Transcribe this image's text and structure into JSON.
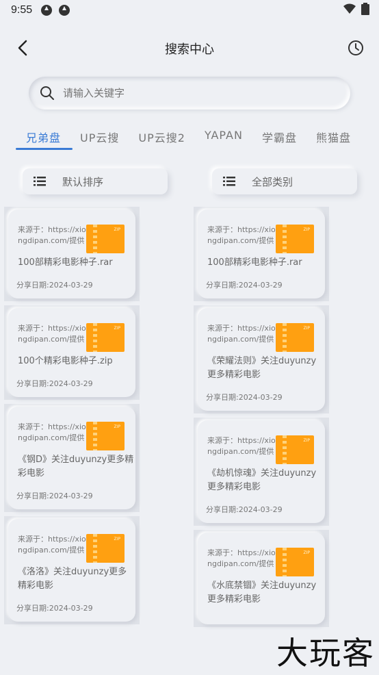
{
  "status_bar": {
    "time": "9:55"
  },
  "header": {
    "title": "搜索中心"
  },
  "search": {
    "placeholder": "请输入关键字"
  },
  "tabs": [
    "兄弟盘",
    "UP云搜",
    "UP云搜2",
    "YAPAN",
    "学霸盘",
    "熊猫盘"
  ],
  "sort": {
    "order_label": "默认排序",
    "category_label": "全部类别"
  },
  "columns": [
    [
      {
        "source": "来源于：https://xiongdipan.com/提供",
        "title": "100部精彩电影种子.rar",
        "date": "分享日期:2024-03-29"
      },
      {
        "source": "来源于：https://xiongdipan.com/提供",
        "title": "100个精彩电影种子.zip",
        "date": "分享日期:2024-03-29"
      },
      {
        "source": "来源于：https://xiongdipan.com/提供",
        "title": "《钢D》关注duyunzy更多精彩电影",
        "date": "分享日期:2024-03-29"
      },
      {
        "source": "来源于：https://xiongdipan.com/提供",
        "title": "《洛洛》关注duyunzy更多精彩电影",
        "date": "分享日期:2024-03-29"
      }
    ],
    [
      {
        "source": "来源于：https://xiongdipan.com/提供",
        "title": "100部精彩电影种子.rar",
        "date": "分享日期:2024-03-29"
      },
      {
        "source": "来源于：https://xiongdipan.com/提供",
        "title": "《荣耀法则》关注duyunzy更多精彩电影",
        "date": "分享日期:2024-03-29"
      },
      {
        "source": "来源于：https://xiongdipan.com/提供",
        "title": "《劫机惊魂》关注duyunzy更多精彩电影",
        "date": "分享日期:2024-03-29"
      },
      {
        "source": "来源于：https://xiongdipan.com/提供",
        "title": "《水底禁锢》关注duyunzy更多精彩电影",
        "date": ""
      }
    ]
  ],
  "watermark": "大玩客",
  "colors": {
    "accent": "#3a7bd5",
    "thumb": "#ffa011",
    "background": "#eef0f4"
  },
  "icons": {
    "back": "chevron-left-icon",
    "history": "clock-icon",
    "search": "search-icon",
    "sort": "list-icon",
    "file": "zip-file-icon"
  }
}
